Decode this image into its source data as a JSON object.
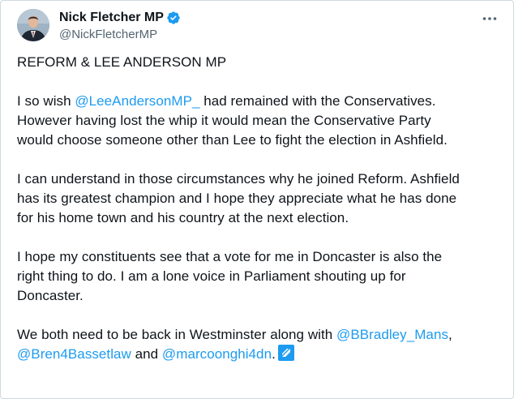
{
  "author": {
    "display_name": "Nick Fletcher MP",
    "handle": "@NickFletcherMP",
    "verified_icon": "verified-badge-icon",
    "verified_color": "#1d9bf0"
  },
  "menu_icon": "more-horizontal-icon",
  "tweet": {
    "heading": "REFORM & LEE ANDERSON MP",
    "p1": {
      "l1_pre": "I so wish ",
      "l1_mention": "@LeeAndersonMP_",
      "l1_post": " had remained with the Conservatives.",
      "l2": "However having lost the whip it would mean the Conservative Party",
      "l3": "would choose someone other than Lee to fight the election in Ashfield."
    },
    "p2": {
      "l1": "I can understand in those circumstances why he joined Reform. Ashfield",
      "l2": "has its greatest champion and I hope they appreciate what he has done",
      "l3": "for his home town and his country at the next election."
    },
    "p3": {
      "l1": "I hope my constituents see that a vote for me in Doncaster is also the",
      "l2": "right thing to do. I am a lone voice in Parliament shouting up for",
      "l3": "Doncaster."
    },
    "p4": {
      "l1_pre": "We both need to be back in Westminster along with ",
      "l1_mention": "@BBradley_Mans",
      "l1_post": ",",
      "l2_mention1": "@Bren4Bassetlaw",
      "l2_mid": " and ",
      "l2_mention2": "@marcoonghi4dn",
      "l2_post": "."
    }
  },
  "colors": {
    "text": "#0f1419",
    "secondary": "#536471",
    "link": "#1d9bf0",
    "border": "#cfd9de"
  }
}
